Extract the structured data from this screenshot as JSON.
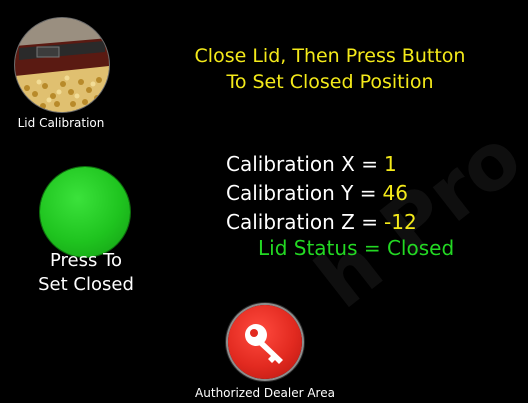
{
  "header": {
    "line1": "Close Lid, Then Press Button",
    "line2": "To Set Closed Position"
  },
  "lid_calibration": {
    "label": "Lid Calibration",
    "icon": "lid-calibration-thumbnail"
  },
  "set_closed_button": {
    "line1": "Press To",
    "line2": "Set Closed",
    "color": "#1fc41f"
  },
  "readouts": {
    "x": {
      "label": "Calibration X =",
      "value": "1"
    },
    "y": {
      "label": "Calibration Y =",
      "value": "46"
    },
    "z": {
      "label": "Calibration Z =",
      "value": "-12"
    },
    "status": "Lid Status = Closed"
  },
  "dealer": {
    "label": "Authorized Dealer Area",
    "icon": "key-icon",
    "color": "#e22a20"
  },
  "colors": {
    "background": "#000000",
    "accent_yellow": "#f4ea1a",
    "status_green": "#23d823"
  }
}
